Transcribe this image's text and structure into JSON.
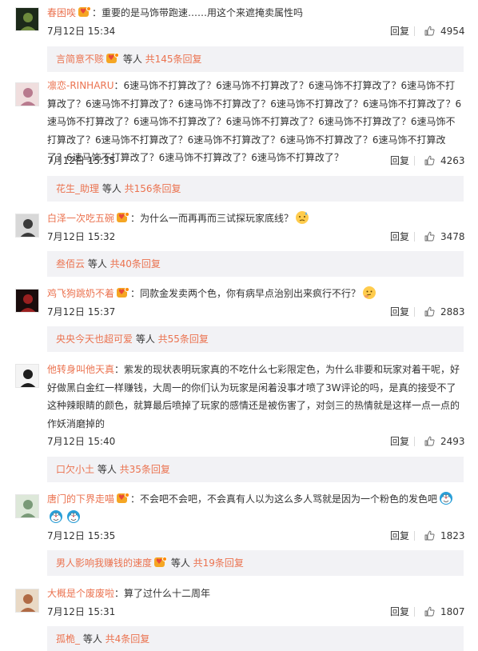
{
  "reply_label": "回复",
  "comments": [
    {
      "user": "春困唉",
      "badge": true,
      "text": "：重要的是马饰带跑速……用这个来遮掩卖属性吗",
      "emoji_after": null,
      "time": "7月12日 15:34",
      "likes": "4954",
      "sub_user": "言简意不赅",
      "sub_badge": true,
      "sub_mid": " 等人 ",
      "sub_more": "共145条回复"
    },
    {
      "user": "凛恋-RINHARU",
      "badge": false,
      "text": "：6速马饰不打算改了？6速马饰不打算改了？6速马饰不打算改了？6速马饰不打算改了？6速马饰不打算改了？6速马饰不打算改了？6速马饰不打算改了？6速马饰不打算改了？6速马饰不打算改了？6速马饰不打算改了？6速马饰不打算改了？6速马饰不打算改了？6速马饰不打算改了？6速马饰不打算改了？6速马饰不打算改了？6速马饰不打算改了？6速马饰不打算改了？6速马饰不打算改了？6速马饰不打算改了？6速马饰不打算改了？",
      "emoji_after": null,
      "time": "7月12日 15:35",
      "likes": "4263",
      "sub_user": "花生_助理",
      "sub_badge": false,
      "sub_mid": " 等人 ",
      "sub_more": "共156条回复"
    },
    {
      "user": "白泽一次吃五碗",
      "badge": true,
      "text": "：为什么一而再再而三试探玩家底线？",
      "emoji_after": "sweat-face-emoji",
      "time": "7月12日 15:32",
      "likes": "3478",
      "sub_user": "叁佰云",
      "sub_badge": false,
      "sub_mid": " 等人 ",
      "sub_more": "共40条回复"
    },
    {
      "user": "鸡飞狗跳奶不着",
      "badge": true,
      "text": "：同款金发卖两个色，你有病早点治别出来疯行不行？",
      "emoji_after": "thinking-face-emoji",
      "time": "7月12日 15:37",
      "likes": "2883",
      "sub_user": "央央今天也超可爱",
      "sub_badge": false,
      "sub_mid": " 等人 ",
      "sub_more": "共55条回复"
    },
    {
      "user": "他转身叫他天真",
      "badge": false,
      "text": "：紫发的现状表明玩家真的不吃什么七彩限定色，为什么非要和玩家对着干呢，好好做黑白金红一样赚钱，大周一的你们认为玩家是闲着没事才喷了3W评论的吗，是真的接受不了这种辣眼睛的颜色，就算最后喷掉了玩家的感情还是被伤害了，对剑三的热情就是这样一点一点的作妖消磨掉的",
      "emoji_after": null,
      "time": "7月12日 15:40",
      "likes": "2493",
      "sub_user": "口欠小土",
      "sub_badge": false,
      "sub_mid": " 等人 ",
      "sub_more": "共35条回复"
    },
    {
      "user": "唐门的下界走喵",
      "badge": true,
      "text": "：不会吧不会吧，不会真有人以为这么多人骂就是因为一个粉色的发色吧",
      "emoji_after": "doraemon-emoji",
      "emoji_row": [
        "doraemon-emoji",
        "doraemon-emoji"
      ],
      "time": "7月12日 15:35",
      "likes": "1823",
      "sub_user": "男人影响我赚钱的速度",
      "sub_badge": true,
      "sub_mid": " 等人 ",
      "sub_more": "共19条回复"
    },
    {
      "user": "大概是个废废啦",
      "badge": false,
      "text": "：算了过什么十二周年",
      "emoji_after": null,
      "time": "7月12日 15:31",
      "likes": "1807",
      "sub_user": "孤桅_",
      "sub_badge": false,
      "sub_mid": " 等人 ",
      "sub_more": "共4条回复"
    }
  ],
  "colors": {
    "username": "#eb7350",
    "subbox_bg": "#f2f2f5",
    "text": "#333333"
  },
  "icons": {
    "like": "thumbs-up-icon",
    "badge": "member-badge-icon"
  }
}
